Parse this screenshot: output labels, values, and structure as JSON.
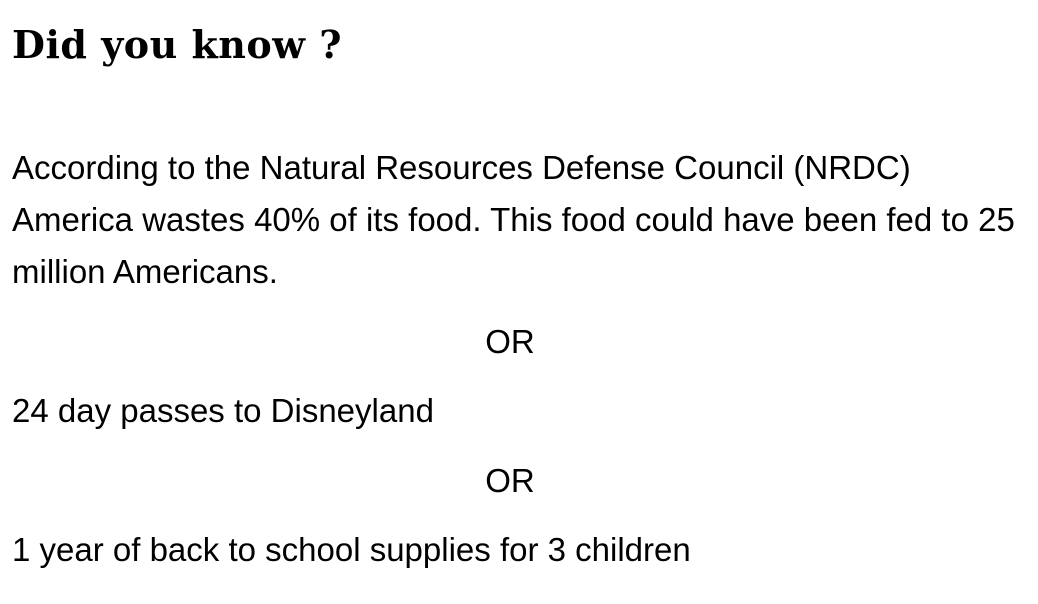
{
  "heading": "Did you know ?",
  "paragraph": "According to the Natural Resources Defense Council (NRDC) America wastes 40% of its food. This food could have been fed to 25 million Americans.",
  "separator_1": "OR",
  "alternative_1": "24 day passes to Disneyland",
  "separator_2": "OR",
  "alternative_2": "1 year of back to school supplies for 3 children"
}
